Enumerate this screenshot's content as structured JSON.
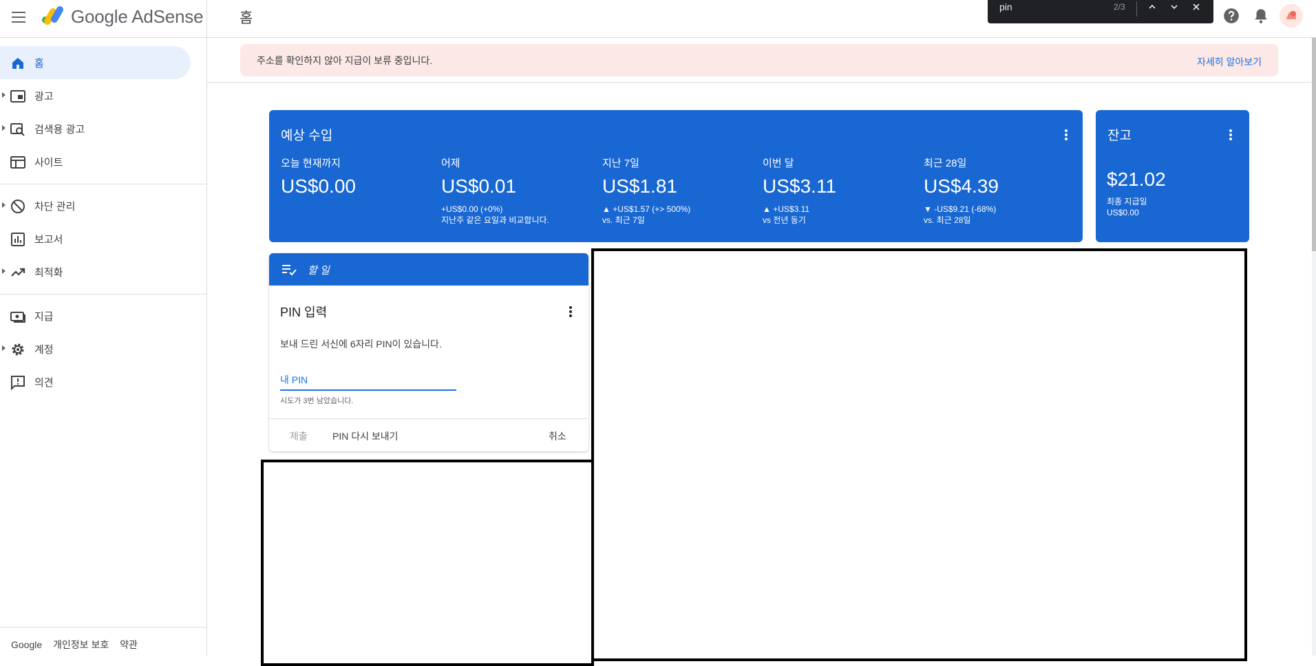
{
  "app": {
    "logo_google": "Google",
    "logo_product": "AdSense",
    "page_title": "홈"
  },
  "find_bar": {
    "query": "pin",
    "count": "2/3"
  },
  "sidebar": {
    "items": [
      {
        "label": "홈"
      },
      {
        "label": "광고"
      },
      {
        "label": "검색용 광고"
      },
      {
        "label": "사이트"
      },
      {
        "label": "차단 관리"
      },
      {
        "label": "보고서"
      },
      {
        "label": "최적화"
      },
      {
        "label": "지급"
      },
      {
        "label": "계정"
      },
      {
        "label": "의견"
      }
    ],
    "footer": {
      "google": "Google",
      "privacy": "개인정보 보호",
      "terms": "약관"
    }
  },
  "alert": {
    "message": "주소를 확인하지 않아 지급이 보류 중입니다.",
    "link": "자세히 알아보기"
  },
  "earnings": {
    "title": "예상 수입",
    "metrics": [
      {
        "label": "오늘 현재까지",
        "value": "US$0.00",
        "delta": "",
        "compare": ""
      },
      {
        "label": "어제",
        "value": "US$0.01",
        "delta": "+US$0.00 (+0%)",
        "compare": "지난주 같은 요일과 비교합니다."
      },
      {
        "label": "지난 7일",
        "value": "US$1.81",
        "delta": "▲ +US$1.57 (+> 500%)",
        "compare": "vs. 최근 7일"
      },
      {
        "label": "이번 달",
        "value": "US$3.11",
        "delta": "▲ +US$3.11",
        "compare": "vs 전년 동기"
      },
      {
        "label": "최근 28일",
        "value": "US$4.39",
        "delta": "▼ -US$9.21 (-68%)",
        "compare": "vs. 최근 28일"
      }
    ]
  },
  "balance": {
    "title": "잔고",
    "amount": "$21.02",
    "last_payment_label": "최종 지급일",
    "last_payment_value": "US$0.00"
  },
  "todo": {
    "header": "할 일",
    "title": "PIN 입력",
    "description": "보내 드린 서신에 6자리 PIN이 있습니다.",
    "input_placeholder": "내 PIN",
    "hint": "시도가 3번 남았습니다.",
    "submit": "제출",
    "resend": "PIN 다시 보내기",
    "cancel": "취소"
  },
  "colors": {
    "primary": "#1967d2",
    "alert_bg": "#fce8e6",
    "active_nav": "#e8f0fe"
  }
}
